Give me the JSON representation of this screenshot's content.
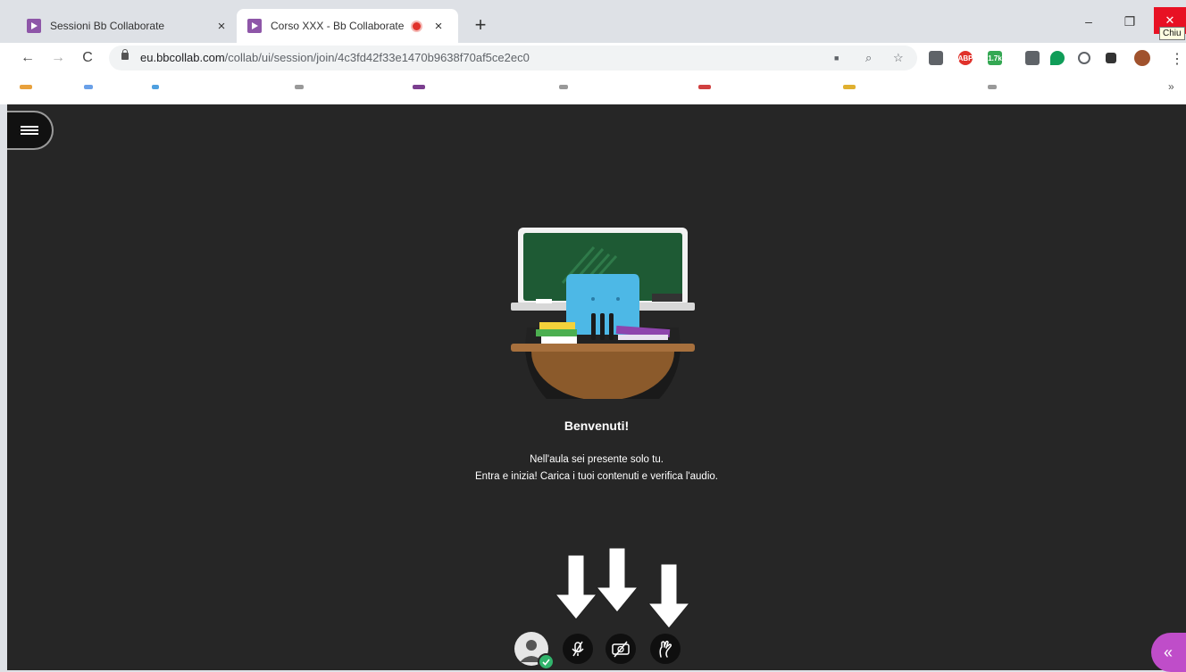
{
  "browser": {
    "tabs": [
      {
        "title": "Sessioni Bb Collaborate",
        "close": "×",
        "active": false
      },
      {
        "title": "Corso XXX - Bb Collaborate",
        "close": "×",
        "active": true,
        "recording": true
      }
    ],
    "new_tab": "+",
    "window_controls": {
      "minimize": "–",
      "maximize": "❐",
      "close": "✕"
    },
    "tooltip": "Chiu",
    "nav": {
      "back": "←",
      "forward": "→",
      "reload": "C"
    },
    "url_host": "eu.bbcollab.com",
    "url_path": "/collab/ui/session/join/4c3fd42f33e1470b9638f70af5ce2ec0",
    "omnibox_icons": {
      "camera": "■",
      "zoom": "⌕",
      "star": "☆"
    },
    "extensions": [
      {
        "name": "drive-icon",
        "color": "#5f6368",
        "label": ""
      },
      {
        "name": "abp-icon",
        "color": "#e0312b",
        "label": "ABP"
      },
      {
        "name": "counter-icon",
        "color": "#34a853",
        "label": "1.7k"
      },
      {
        "name": "pen-icon",
        "color": "#5f6368",
        "label": ""
      },
      {
        "name": "chat-icon",
        "color": "#0f9d58",
        "label": ""
      },
      {
        "name": "circle-icon",
        "color": "#ffffff",
        "label": ""
      },
      {
        "name": "puzzle-icon",
        "color": "#ffffff",
        "label": ""
      },
      {
        "name": "profile-icon",
        "color": "#a0522d",
        "label": ""
      }
    ],
    "bookmarks_more": "»"
  },
  "session": {
    "welcome_title": "Benvenuti!",
    "welcome_line1": "Nell'aula sei presente solo tu.",
    "welcome_line2": "Entra e inizia! Carica i tuoi contenuti e verifica l'audio.",
    "panel_toggle": "«"
  },
  "colors": {
    "app_bg": "#262626",
    "brand_purple": "#bf4dc9",
    "status_green": "#31b46c",
    "close_red": "#e81123"
  }
}
